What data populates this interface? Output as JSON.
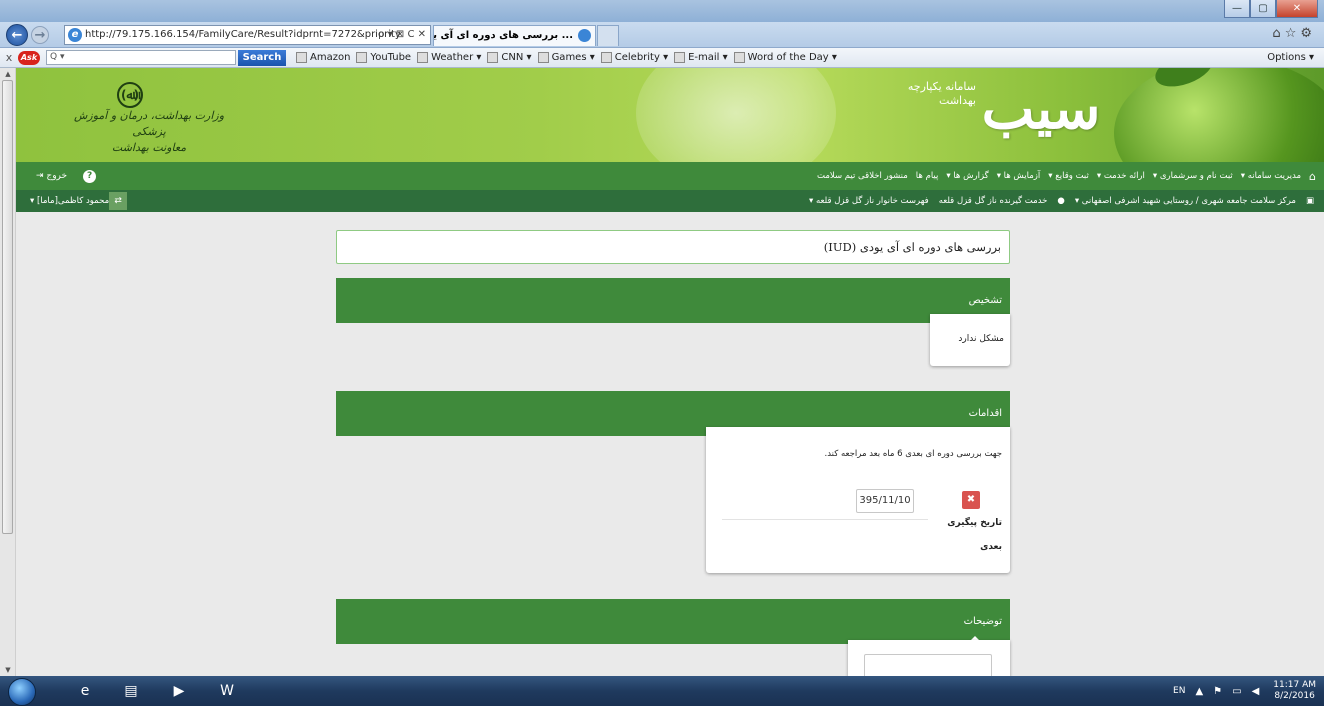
{
  "browser": {
    "url": "http://79.175.166.154/FamilyCare/Result?idprnt=7272&priority",
    "tab_title": "... بررسی های دوره ای آی یودی",
    "window_buttons": {
      "minimize": "—",
      "maximize": "▢",
      "close": "✕"
    },
    "address_tools": "ρ ▾ ⊠ C ✕"
  },
  "toolbar": {
    "close": "x",
    "ask": "Ask",
    "search_placeholder": "Q ▾",
    "search_button": "Search",
    "links": [
      "Amazon",
      "YouTube",
      "Weather ▾",
      "CNN ▾",
      "Games ▾",
      "Celebrity ▾",
      "E-mail ▾",
      "Word of the Day ▾"
    ],
    "options": "Options ▾"
  },
  "site": {
    "logo": "سیب",
    "logo_sub": "سامانه یکپارچه بهداشت",
    "ministry_emblem": "(ﷲ)",
    "ministry_line1": "وزارت بهداشت، درمان و آموزش پزشکی",
    "ministry_line2": "معاونت بهداشت",
    "nav": {
      "items": [
        "مدیریت سامانه ▾",
        "ثبت نام و سرشماری ▾",
        "ارائه خدمت ▾",
        "ثبت وقایع ▾",
        "آزمایش ها ▾",
        "گزارش ها ▾",
        "پیام ها",
        "منشور اخلاقی تیم سلامت"
      ],
      "exit": "خروج"
    },
    "subnav": {
      "center": "مرکز سلامت جامعه شهری / روستایی شهید اشرفی اصفهانی ▾",
      "service_recipient": "خدمت گیرنده ناز گل قزل قلعه",
      "family_list": "فهرست خانوار ناز گل قزل قلعه ▾",
      "user": "محمود کاظمی[ماما] ▾"
    }
  },
  "page": {
    "title": "بررسی های دوره ای آی یودی (IUD)",
    "diagnosis": {
      "header": "تشخیص",
      "value": "مشکل ندارد"
    },
    "actions": {
      "header": "اقدامات",
      "text": "جهت بررسی دوره ای بعدی 6 ماه بعد مراجعه کند.",
      "followup_label": "تاریخ پیگیری بعدی",
      "followup_date": "395/11/10",
      "delete": "✖"
    },
    "notes": {
      "header": "توضیحات",
      "value": ""
    }
  },
  "taskbar": {
    "lang": "EN",
    "time": "11:17 AM",
    "date": "8/2/2016"
  }
}
